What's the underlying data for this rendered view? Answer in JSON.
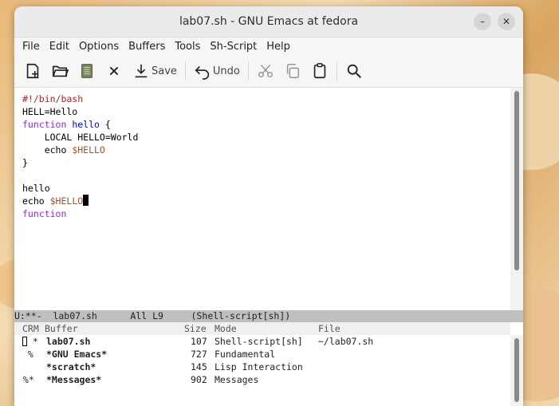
{
  "window": {
    "title": "lab07.sh - GNU Emacs at fedora",
    "controls": [
      "minimize",
      "close"
    ]
  },
  "menu": [
    "File",
    "Edit",
    "Options",
    "Buffers",
    "Tools",
    "Sh-Script",
    "Help"
  ],
  "toolbar": {
    "new_icon": "new-file-icon",
    "open_icon": "open-folder-icon",
    "dired_icon": "dired-icon",
    "close_icon": "close-icon",
    "save_label": "Save",
    "undo_label": "Undo",
    "cut_icon": "cut-icon",
    "copy_icon": "copy-icon",
    "paste_icon": "paste-icon",
    "search_icon": "search-icon"
  },
  "editor": {
    "l1": "#!/bin/bash",
    "l2": "HELL=Hello",
    "l3a": "function",
    "l3b": " ",
    "l3c": "hello",
    "l3d": " {",
    "l4a": "    LOCAL HELLO=World",
    "l5a": "    echo ",
    "l5b": "$HELLO",
    "l6": "}",
    "l8": "hello",
    "l9a": "echo ",
    "l9b": "$HELLO",
    "l10": "function"
  },
  "modeline": {
    "text": "U:**-  lab07.sh      All L9     (Shell-script[sh])"
  },
  "buffer_list": {
    "headers": {
      "crm": "CRM",
      "buffer": "Buffer",
      "size": "Size",
      "mode": "Mode",
      "file": "File"
    },
    "rows": [
      {
        "crm": " *",
        "name": "lab07.sh",
        "size": "107",
        "mode": "Shell-script[sh]",
        "file": "~/lab07.sh"
      },
      {
        "crm": " %",
        "name": "*GNU Emacs*",
        "size": "727",
        "mode": "Fundamental",
        "file": ""
      },
      {
        "crm": "",
        "name": "*scratch*",
        "size": "145",
        "mode": "Lisp Interaction",
        "file": ""
      },
      {
        "crm": " %*",
        "name": "*Messages*",
        "size": "902",
        "mode": "Messages",
        "file": ""
      }
    ]
  },
  "colors": {
    "keyword": "#a020f0",
    "function_name": "#0000ff",
    "variable": "#a0522d",
    "modeline_bg": "#bfbfbf"
  }
}
